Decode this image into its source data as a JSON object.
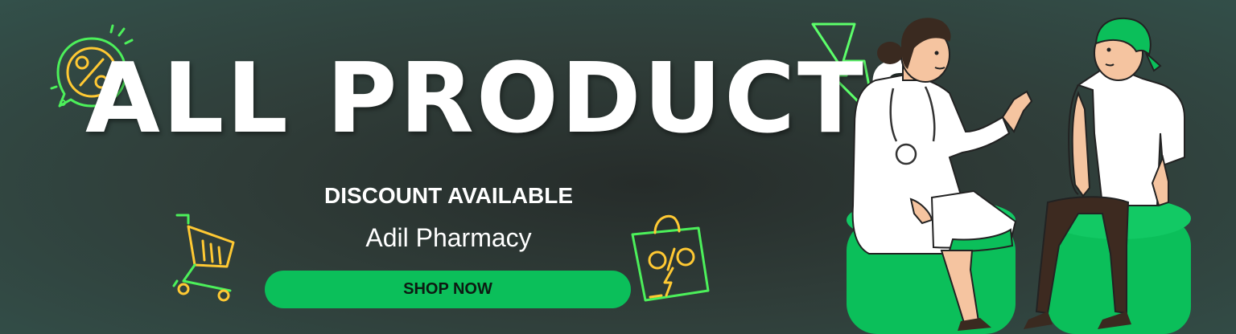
{
  "banner": {
    "headline": "ALL PRODUCTS",
    "discount_text": "DISCOUNT AVAILABLE",
    "brand_name": "Adil Pharmacy",
    "cta_label": "SHOP NOW"
  },
  "icons": {
    "percent_badge": "percent-badge-icon",
    "shopping_cart": "shopping-cart-icon",
    "shopping_bag": "shopping-bag-percent-icon",
    "lightning": "lightning-bolt-icon"
  },
  "colors": {
    "background": "#2f3c38",
    "accent_green": "#0bbf5a",
    "neon_green": "#5cff6a",
    "neon_yellow": "#ffcc33",
    "text": "#ffffff"
  }
}
